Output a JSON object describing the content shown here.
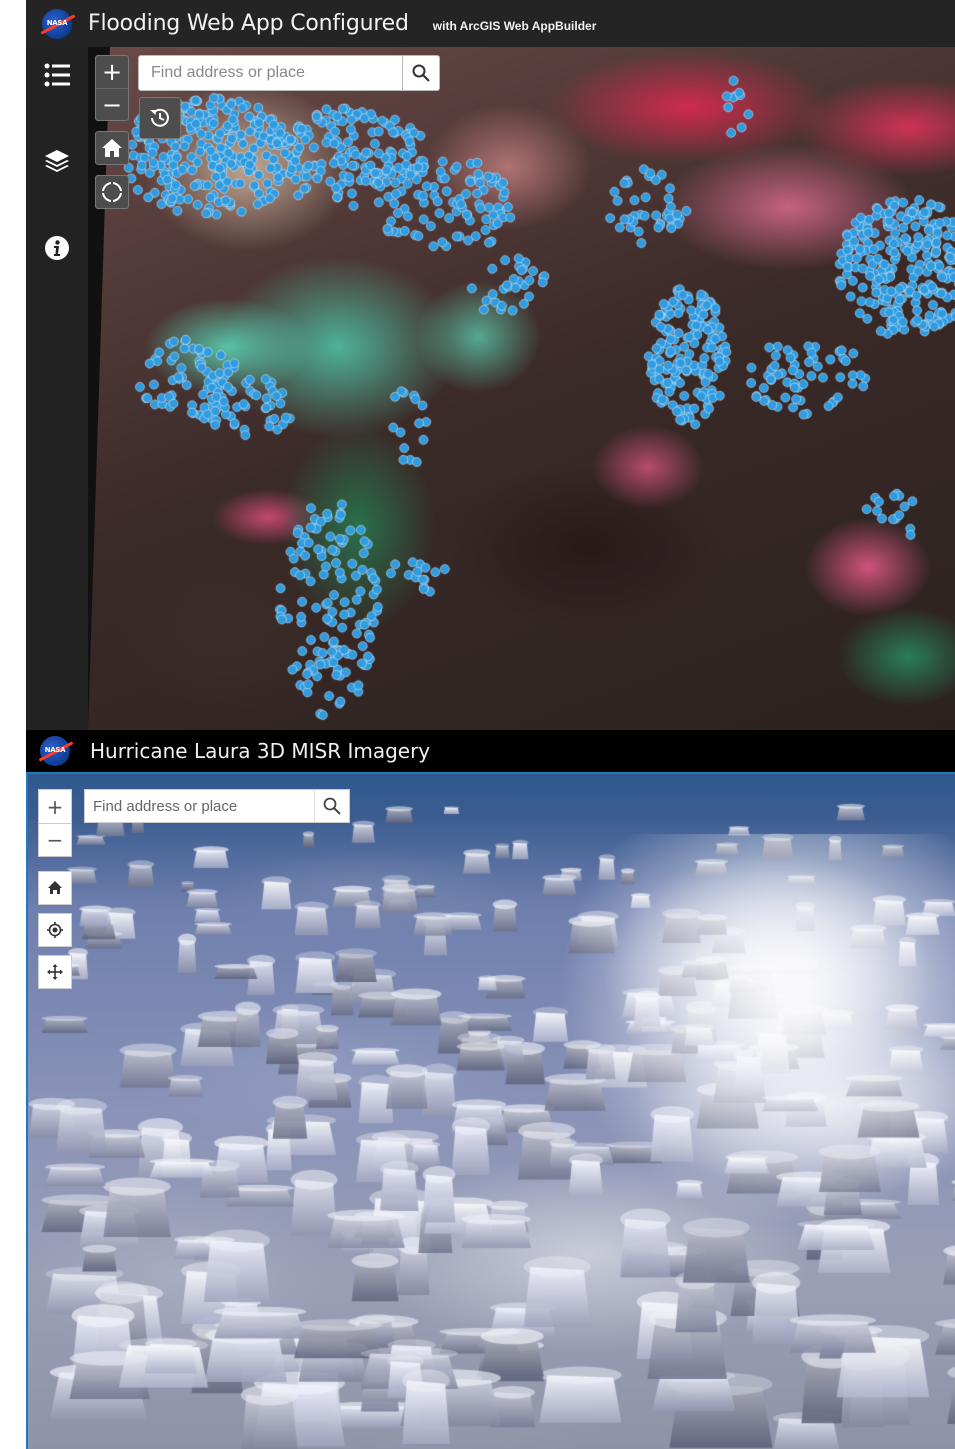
{
  "top_app": {
    "logo_label": "NASA",
    "title": "Flooding Web App Configured",
    "subtitle": "with ArcGIS Web AppBuilder",
    "sidebar": [
      {
        "name": "legend",
        "icon": "list-icon"
      },
      {
        "name": "layers",
        "icon": "layers-icon"
      },
      {
        "name": "about",
        "icon": "info-icon"
      }
    ],
    "map_controls": {
      "zoom_in": "+",
      "zoom_out": "−",
      "home": "home-icon",
      "locate": "locate-icon",
      "time_slider": "history-icon"
    },
    "search": {
      "value": "",
      "placeholder": "Find address or place"
    },
    "colors": {
      "header_bg": "#242424",
      "flood_point": "#2f9be0"
    }
  },
  "bottom_app": {
    "logo_label": "NASA",
    "title": "Hurricane Laura 3D MISR Imagery",
    "map_controls": {
      "zoom_in": "+",
      "zoom_out": "−",
      "home": "home-icon",
      "locate": "locate-icon",
      "navigation": "pan-icon"
    },
    "search": {
      "value": "",
      "placeholder": "Find address or place"
    },
    "colors": {
      "header_bg": "#000000",
      "accent": "#1f7bc1"
    }
  }
}
